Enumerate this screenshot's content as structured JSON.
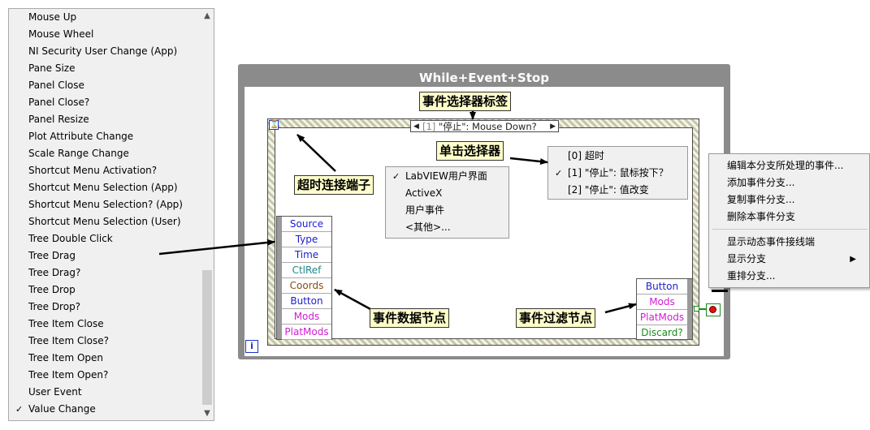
{
  "event_list": {
    "items": [
      {
        "label": "Mouse Up",
        "checked": false
      },
      {
        "label": "Mouse Wheel",
        "checked": false
      },
      {
        "label": "NI Security User Change (App)",
        "checked": false
      },
      {
        "label": "Pane Size",
        "checked": false
      },
      {
        "label": "Panel Close",
        "checked": false
      },
      {
        "label": "Panel Close?",
        "checked": false
      },
      {
        "label": "Panel Resize",
        "checked": false
      },
      {
        "label": "Plot Attribute Change",
        "checked": false
      },
      {
        "label": "Scale Range Change",
        "checked": false
      },
      {
        "label": "Shortcut Menu Activation?",
        "checked": false
      },
      {
        "label": "Shortcut Menu Selection (App)",
        "checked": false
      },
      {
        "label": "Shortcut Menu Selection? (App)",
        "checked": false
      },
      {
        "label": "Shortcut Menu Selection (User)",
        "checked": false
      },
      {
        "label": "Tree Double Click",
        "checked": false
      },
      {
        "label": "Tree Drag",
        "checked": false
      },
      {
        "label": "Tree Drag?",
        "checked": false
      },
      {
        "label": "Tree Drop",
        "checked": false
      },
      {
        "label": "Tree Drop?",
        "checked": false
      },
      {
        "label": "Tree Item Close",
        "checked": false
      },
      {
        "label": "Tree Item Close?",
        "checked": false
      },
      {
        "label": "Tree Item Open",
        "checked": false
      },
      {
        "label": "Tree Item Open?",
        "checked": false
      },
      {
        "label": "User Event",
        "checked": false
      },
      {
        "label": "Value Change",
        "checked": true
      }
    ],
    "check_glyph": "✓",
    "scroll_up_glyph": "▲",
    "scroll_down_glyph": "▼"
  },
  "while_loop": {
    "title": "While+Event+Stop",
    "iteration_terminal": "i"
  },
  "event_structure": {
    "timeout_terminal": "⌛",
    "selector": {
      "decrement": "◀",
      "index": "[1]",
      "text": " \"停止\": Mouse Down?",
      "increment": "▶"
    }
  },
  "event_data_node": [
    "Source",
    "Type",
    "Time",
    "CtlRef",
    "Coords",
    "Button",
    "Mods",
    "PlatMods"
  ],
  "event_filter_node": [
    "Button",
    "Mods",
    "PlatMods",
    "Discard?"
  ],
  "node_colors": {
    "Source": "#1c1ccc",
    "Type": "#1c1ccc",
    "Time": "#1c1ccc",
    "CtlRef": "#1e8a8a",
    "Coords": "#8b4a10",
    "Button": "#1c1ccc",
    "Mods": "#d21cd2",
    "PlatMods": "#d21cd2",
    "Discard?": "#1c8a1c"
  },
  "source_menu": {
    "items": [
      {
        "label": "LabVIEW用户界面",
        "checked": true
      },
      {
        "label": "ActiveX",
        "checked": false
      },
      {
        "label": "用户事件",
        "checked": false
      },
      {
        "label": "<其他>...",
        "checked": false
      }
    ]
  },
  "case_menu": {
    "items": [
      {
        "label": "[0] 超时",
        "checked": false
      },
      {
        "label": "[1] \"停止\": 鼠标按下？",
        "checked": true
      },
      {
        "label": "[2] \"停止\": 值改变",
        "checked": false
      }
    ]
  },
  "context_menu": {
    "group1": [
      "编辑本分支所处理的事件...",
      "添加事件分支...",
      "复制事件分支...",
      "删除本事件分支"
    ],
    "group2": [
      "显示动态事件接线端",
      "显示分支",
      "重排分支..."
    ],
    "submenu_glyph": "▶"
  },
  "callouts": {
    "event_selector_label": "事件选择器标签",
    "click_selector": "单击选择器",
    "timeout_terminal": "超时连接端子",
    "event_data_node": "事件数据节点",
    "event_filter_node": "事件过滤节点"
  },
  "colors": {
    "terminal_blue": "#1a33cc",
    "stop_red": "#e01010",
    "bool_green": "#1c8a1c",
    "loop_gray": "#8b8b8b",
    "callout_bg": "#ffffcc"
  }
}
